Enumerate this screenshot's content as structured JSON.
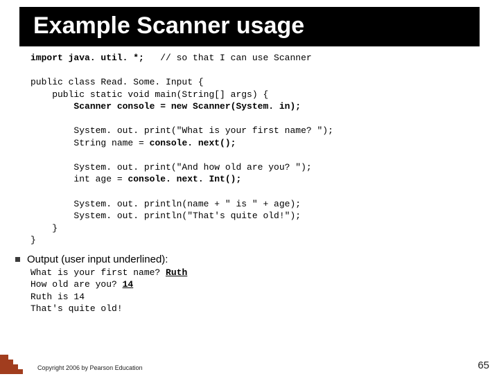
{
  "title": "Example Scanner usage",
  "code": {
    "l1a": "import java. util. *;",
    "l1b": "   // so that I can use Scanner",
    "l2": "",
    "l3": "public class Read. Some. Input {",
    "l4": "    public static void main(String[] args) {",
    "l5": "        Scanner console = new Scanner(System. in);",
    "l6": "",
    "l7": "        System. out. print(\"What is your first name? \");",
    "l8a": "        String name = ",
    "l8b": "console. next();",
    "l9": "",
    "l10": "        System. out. print(\"And how old are you? \");",
    "l11a": "        int age = ",
    "l11b": "console. next. Int();",
    "l12": "",
    "l13": "        System. out. println(name + \" is \" + age);",
    "l14": "        System. out. println(\"That's quite old!\");",
    "l15": "    }",
    "l16": "}"
  },
  "output_heading": "Output (user input underlined):",
  "output": {
    "o1a": "What is your first name? ",
    "o1b": "Ruth",
    "o2a": "How old are you? ",
    "o2b": "14",
    "o3": "Ruth is 14",
    "o4": "That's quite old!"
  },
  "copyright": "Copyright 2006 by Pearson Education",
  "page_number": "65"
}
